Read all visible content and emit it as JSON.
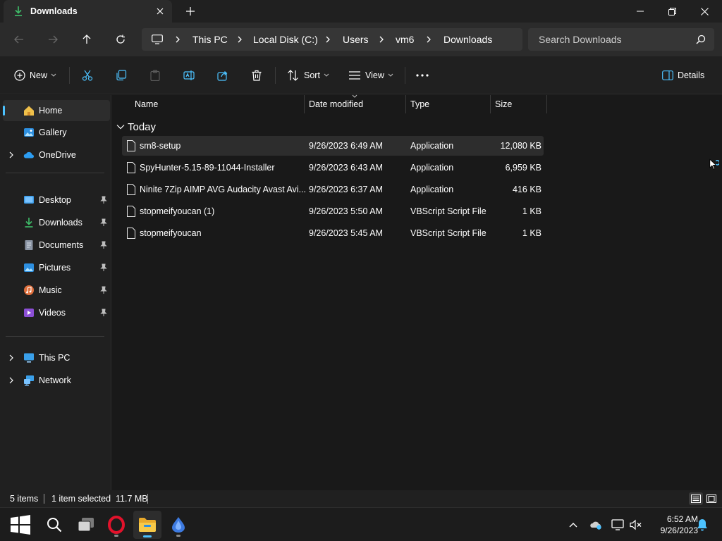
{
  "window": {
    "tab_title": "Downloads",
    "tab_icon": "download-icon"
  },
  "nav": {
    "breadcrumbs": [
      "This PC",
      "Local Disk (C:)",
      "Users",
      "vm6",
      "Downloads"
    ],
    "search_placeholder": "Search Downloads"
  },
  "toolbar": {
    "new_label": "New",
    "sort_label": "Sort",
    "view_label": "View",
    "details_label": "Details"
  },
  "sidebar": {
    "items": [
      {
        "label": "Home",
        "icon": "home-icon"
      },
      {
        "label": "Gallery",
        "icon": "gallery-icon"
      },
      {
        "label": "OneDrive",
        "icon": "onedrive-icon"
      },
      {
        "label": "Desktop",
        "icon": "desktop-icon"
      },
      {
        "label": "Downloads",
        "icon": "download-icon"
      },
      {
        "label": "Documents",
        "icon": "documents-icon"
      },
      {
        "label": "Pictures",
        "icon": "pictures-icon"
      },
      {
        "label": "Music",
        "icon": "music-icon"
      },
      {
        "label": "Videos",
        "icon": "videos-icon"
      },
      {
        "label": "This PC",
        "icon": "pc-icon"
      },
      {
        "label": "Network",
        "icon": "network-icon"
      }
    ]
  },
  "files": {
    "columns": [
      "Name",
      "Date modified",
      "Type",
      "Size"
    ],
    "group_label": "Today",
    "rows": [
      {
        "name": "sm8-setup",
        "date": "9/26/2023 6:49 AM",
        "type": "Application",
        "size": "12,080 KB"
      },
      {
        "name": "SpyHunter-5.15-89-11044-Installer",
        "date": "9/26/2023 6:43 AM",
        "type": "Application",
        "size": "6,959 KB"
      },
      {
        "name": "Ninite 7Zip AIMP AVG Audacity Avast Avi...",
        "date": "9/26/2023 6:37 AM",
        "type": "Application",
        "size": "416 KB"
      },
      {
        "name": "stopmeifyoucan (1)",
        "date": "9/26/2023 5:50 AM",
        "type": "VBScript Script File",
        "size": "1 KB"
      },
      {
        "name": "stopmeifyoucan",
        "date": "9/26/2023 5:45 AM",
        "type": "VBScript Script File",
        "size": "1 KB"
      }
    ]
  },
  "status": {
    "item_count": "5 items",
    "selection": "1 item selected  11.7 MB"
  },
  "taskbar": {
    "time": "6:52 AM",
    "date": "9/26/2023"
  },
  "colors": {
    "accent": "#4cc2ff",
    "window_bg": "#191919",
    "panel_bg": "#202020"
  }
}
